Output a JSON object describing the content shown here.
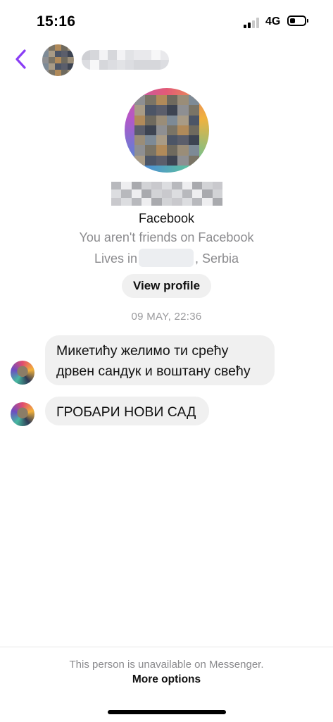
{
  "status_bar": {
    "time": "15:16",
    "network": "4G",
    "battery_level": 0.35
  },
  "header": {
    "back_icon": "chevron-left-icon",
    "accent_color": "#8a3df5"
  },
  "profile": {
    "platform": "Facebook",
    "friend_status": "You aren't friends on Facebook",
    "lives_prefix": "Lives in",
    "lives_suffix": ", Serbia",
    "view_profile_label": "View profile"
  },
  "conversation": {
    "timestamp": "09 MAY, 22:36",
    "messages": [
      {
        "line1": "Микетићу желимо ти срећу",
        "line2": "дрвен сандук и воштану свећу"
      },
      {
        "line1": "ГРОБАРИ НОВИ САД"
      }
    ]
  },
  "footer": {
    "unavailable_text": "This person is unavailable on Messenger.",
    "more_options_label": "More options"
  }
}
